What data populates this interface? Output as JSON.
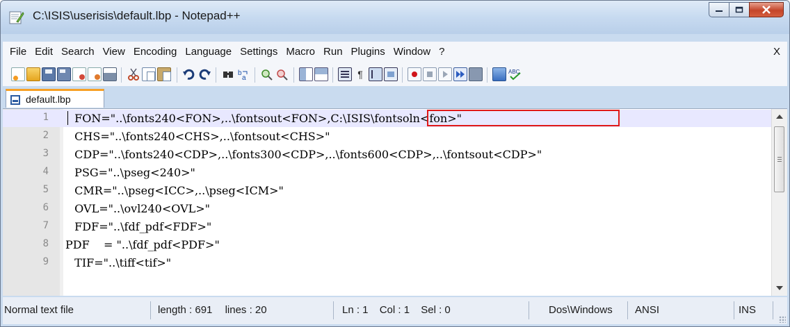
{
  "window": {
    "title": "C:\\ISIS\\userisis\\default.lbp - Notepad++"
  },
  "menu": {
    "items": [
      "File",
      "Edit",
      "Search",
      "View",
      "Encoding",
      "Language",
      "Settings",
      "Macro",
      "Run",
      "Plugins",
      "Window",
      "?"
    ],
    "close_doc": "X"
  },
  "toolbar": {
    "icons": [
      "new-file-icon",
      "open-file-icon",
      "save-icon",
      "save-all-icon",
      "close-icon",
      "close-all-icon",
      "print-icon",
      "cut-icon",
      "copy-icon",
      "paste-icon",
      "undo-icon",
      "redo-icon",
      "find-icon",
      "replace-icon",
      "zoom-in-icon",
      "zoom-out-icon",
      "sync-vertical-icon",
      "sync-horizontal-icon",
      "word-wrap-icon",
      "show-all-chars-icon",
      "indent-guide-icon",
      "doc-map-icon",
      "record-macro-icon",
      "stop-record-icon",
      "play-macro-icon",
      "run-macro-multiple-icon",
      "save-macro-icon",
      "launch-browser-icon",
      "spell-check-icon"
    ]
  },
  "tabs": [
    {
      "label": "default.lbp"
    }
  ],
  "editor": {
    "current_line": 1,
    "lines": [
      {
        "no": "1",
        "text": "  FON=\"..\\fonts240<FON>,..\\fontsout<FON>,C:\\ISIS\\fontsoln<fon>\""
      },
      {
        "no": "2",
        "text": "  CHS=\"..\\fonts240<CHS>,..\\fontsout<CHS>\""
      },
      {
        "no": "3",
        "text": "  CDP=\"..\\fonts240<CDP>,..\\fonts300<CDP>,..\\fonts600<CDP>,..\\fontsout<CDP>\""
      },
      {
        "no": "4",
        "text": "  PSG=\"..\\pseg<240>\""
      },
      {
        "no": "5",
        "text": "  CMR=\"..\\pseg<ICC>,..\\pseg<ICM>\""
      },
      {
        "no": "6",
        "text": "  OVL=\"..\\ovl240<OVL>\""
      },
      {
        "no": "7",
        "text": "  FDF=\"..\\fdf_pdf<FDF>\""
      },
      {
        "no": "8",
        "text": "PDF    = \"..\\fdf_pdf<PDF>\""
      },
      {
        "no": "9",
        "text": "  TIF=\"..\\tiff<tif>\""
      }
    ]
  },
  "statusbar": {
    "file_type": "Normal text file",
    "length": "length : 691",
    "lines": "lines : 20",
    "ln": "Ln : 1",
    "col": "Col : 1",
    "sel": "Sel : 0",
    "eol": "Dos\\Windows",
    "encoding": "ANSI",
    "mode": "INS"
  },
  "colors": {
    "highlight_box": "#e01818",
    "tab_accent": "#f7a024",
    "current_line_bg": "#e8e8ff"
  }
}
